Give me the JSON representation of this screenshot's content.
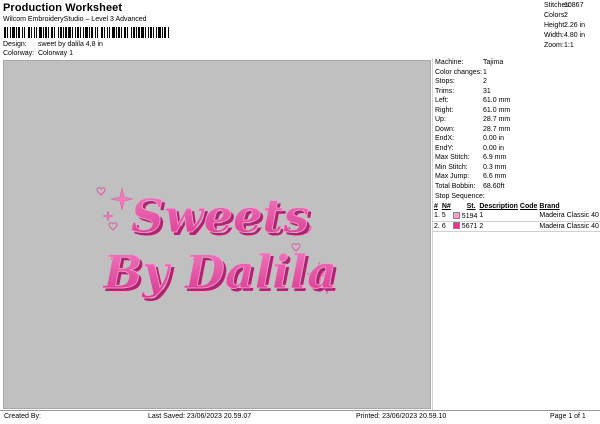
{
  "header": {
    "title": "Production Worksheet",
    "subtitle": "Wilcom EmbroideryStudio – Level 3 Advanced",
    "barcode_icon": "barcode-icon"
  },
  "meta": {
    "design_label": "Design:",
    "design_value": "sweet by dalila 4,8 in",
    "colorway_label": "Colorway:",
    "colorway_value": "Colorway 1"
  },
  "top_stats": [
    {
      "label": "Stitches:",
      "value": "10867"
    },
    {
      "label": "Colors:",
      "value": "2"
    },
    {
      "label": "Height:",
      "value": "2.26 in"
    },
    {
      "label": "Width:",
      "value": "4.80 in"
    },
    {
      "label": "Zoom:",
      "value": "1:1"
    }
  ],
  "design_preview": {
    "line1": "Sweets",
    "line2": "By Dalila",
    "thread_color": "#e94aa6",
    "highlight_color": "#f7a3d3",
    "shadow_color": "#a8286f",
    "background": "#c0c0c0"
  },
  "properties": [
    {
      "label": "Machine:",
      "value": "Tajima"
    },
    {
      "label": "Color changes:",
      "value": "1"
    },
    {
      "label": "Stops:",
      "value": "2"
    },
    {
      "label": "Trims:",
      "value": "31"
    },
    {
      "label": "Left:",
      "value": "61.0 mm"
    },
    {
      "label": "Right:",
      "value": "61.0 mm"
    },
    {
      "label": "Up:",
      "value": "28.7 mm"
    },
    {
      "label": "Down:",
      "value": "28.7 mm"
    },
    {
      "label": "EndX:",
      "value": "0.00 in"
    },
    {
      "label": "EndY:",
      "value": "0.00 in"
    },
    {
      "label": "Max Stitch:",
      "value": "6.9 mm"
    },
    {
      "label": "Min Stitch:",
      "value": "0.3 mm"
    },
    {
      "label": "Max Jump:",
      "value": "6.6 mm"
    },
    {
      "label": "Total Bobbin:",
      "value": "68.60ft"
    }
  ],
  "stop_sequence": {
    "label": "Stop Sequence:",
    "columns": [
      "#",
      "N#",
      "",
      "St.",
      "Description",
      "Code",
      "Brand"
    ],
    "rows": [
      {
        "num": "1.",
        "needle": "5",
        "color": "#f4a0c8",
        "stitches": "5194",
        "description": "1",
        "code": "",
        "brand": "Madeira Classic 40"
      },
      {
        "num": "2.",
        "needle": "6",
        "color": "#e8358f",
        "stitches": "5671",
        "description": "2",
        "code": "",
        "brand": "Madeira Classic 40"
      }
    ]
  },
  "footer": {
    "created_by": "Created By:",
    "last_saved": "Last Saved: 23/06/2023 20.59.07",
    "printed": "Printed: 23/06/2023 20.59.10",
    "page": "Page 1 of 1"
  }
}
